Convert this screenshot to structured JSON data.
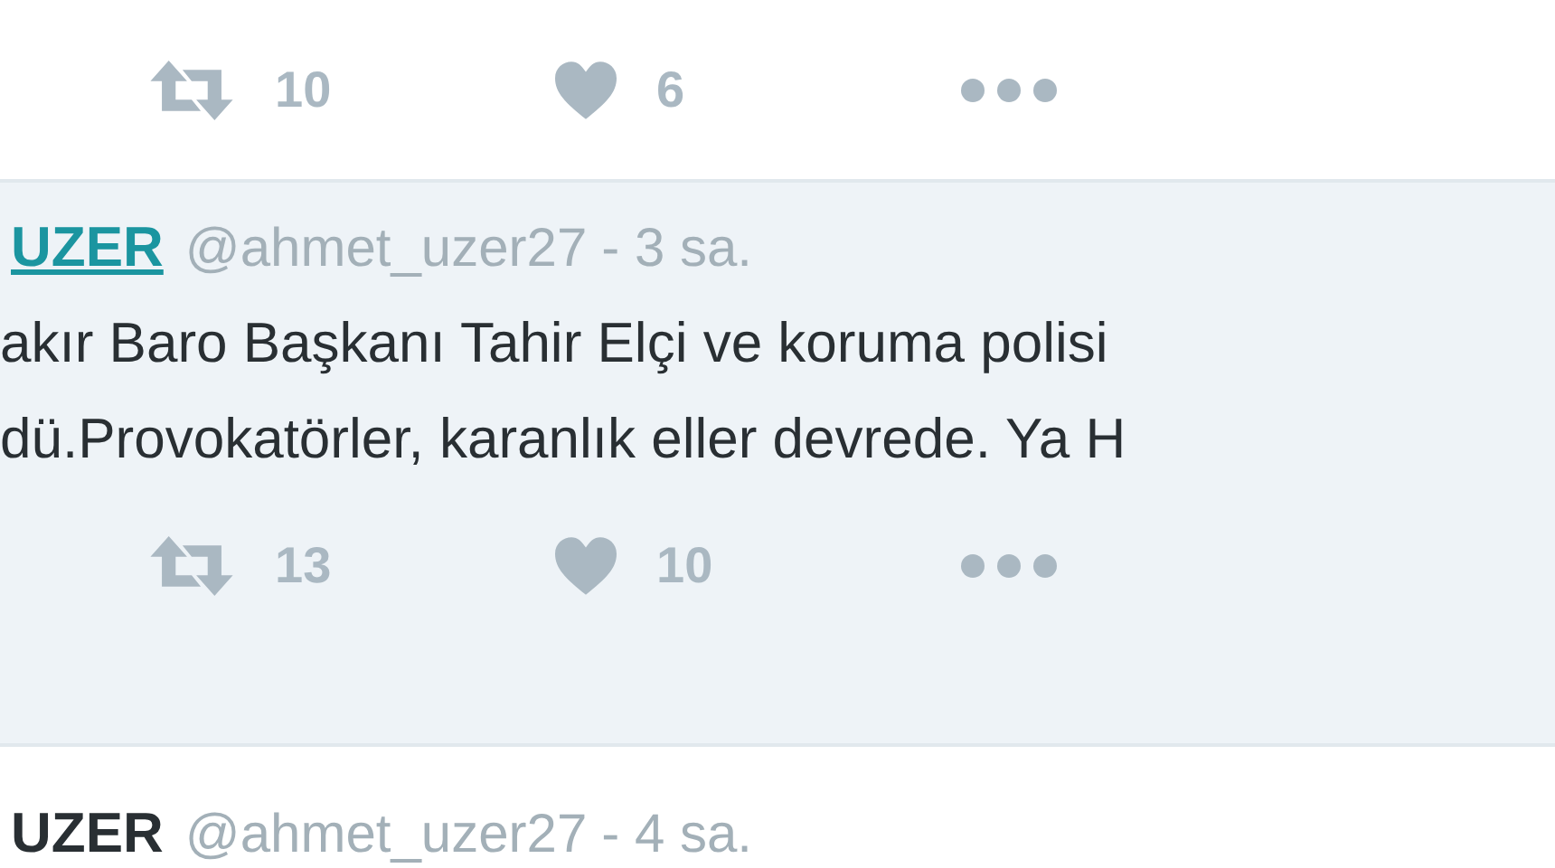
{
  "tweets": [
    {
      "highlighted": false,
      "actions": {
        "retweets": "10",
        "likes": "6"
      }
    },
    {
      "highlighted": true,
      "header": {
        "name": "UZER",
        "name_hovered": true,
        "handle": "@ahmet_uzer27",
        "time": "- 3 sa."
      },
      "text_lines": [
        "akır Baro Başkanı Tahir Elçi ve koruma polisi",
        "dü.Provokatörler, karanlık eller devrede. Ya H"
      ],
      "actions": {
        "retweets": "13",
        "likes": "10"
      }
    },
    {
      "highlighted": false,
      "header": {
        "name": "UZER",
        "name_hovered": false,
        "handle": "@ahmet_uzer27",
        "time": "- 4 sa."
      }
    }
  ]
}
